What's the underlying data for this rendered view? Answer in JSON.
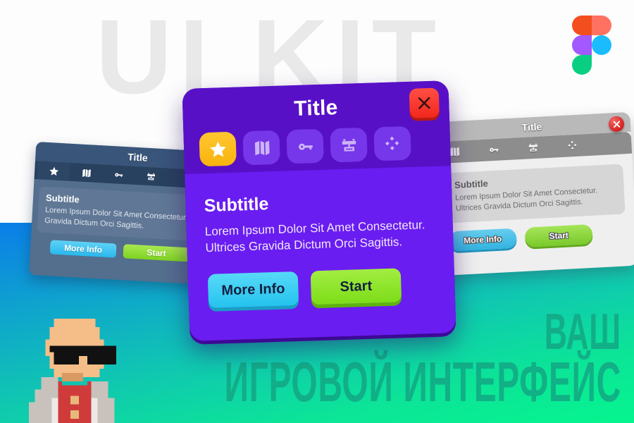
{
  "background": {
    "watermark_text": "UI KIT",
    "top_color": "#fdfdfd",
    "gradient_from": "#0a7ee8",
    "gradient_to": "#05f58f"
  },
  "figma_logo": {
    "name": "figma-logo",
    "colors": {
      "red": "#f24e1e",
      "salmon": "#ff7262",
      "purple": "#a259ff",
      "blue": "#1abcfe",
      "green": "#0acf83"
    }
  },
  "promo": {
    "line1": "ВАШ",
    "line2": "ИГРОВОЙ ИНТЕРФЕЙС",
    "color": "#13a583"
  },
  "mascot": {
    "name": "pixel-art-character",
    "skin": "#f5bd87",
    "skin_shadow": "#d99a63",
    "glasses": "#111111",
    "shirt": "#cf3b3b",
    "jacket": "#c9c1bb",
    "buttons": "#e8b87a"
  },
  "icons": {
    "star": "star-icon",
    "map": "map-icon",
    "key": "key-icon",
    "chest": "chest-icon",
    "gamepad": "gamepad-icon",
    "close": "close-icon"
  },
  "main_dialog": {
    "title": "Title",
    "subtitle": "Subtitle",
    "body": "Lorem Ipsum Dolor Sit Amet Consectetur. Ultrices Gravida Dictum Orci Sagittis.",
    "close_label": "Close",
    "accent": "#6a1df0",
    "header": "#5810c7",
    "active_tab_color": "#ffc731",
    "tabs": [
      {
        "label": "Favorites",
        "icon": "star-icon",
        "active": true
      },
      {
        "label": "Map",
        "icon": "map-icon",
        "active": false
      },
      {
        "label": "Keys",
        "icon": "key-icon",
        "active": false
      },
      {
        "label": "Inventory",
        "icon": "chest-icon",
        "active": false
      },
      {
        "label": "Controls",
        "icon": "gamepad-icon",
        "active": false
      }
    ],
    "buttons": {
      "more_info": "More Info",
      "start": "Start",
      "more_info_color": "#24c3ee",
      "start_color": "#7ddd18"
    }
  },
  "dark_dialog": {
    "title": "Title",
    "subtitle": "Subtitle",
    "body": "Lorem Ipsum Dolor Sit Amet Consectetur. Ultrices Gravida Dictum Orci Sagittis.",
    "accent": "#546e8e",
    "header": "#39557a",
    "tabs": [
      {
        "label": "Favorites",
        "icon": "star-icon",
        "active": true
      },
      {
        "label": "Map",
        "icon": "map-icon",
        "active": false
      },
      {
        "label": "Keys",
        "icon": "key-icon",
        "active": false
      },
      {
        "label": "Inventory",
        "icon": "chest-icon",
        "active": false
      }
    ],
    "buttons": {
      "more_info": "More Info",
      "start": "Start"
    }
  },
  "light_dialog": {
    "title": "Title",
    "subtitle": "Subtitle",
    "body": "Lorem Ipsum Dolor Sit Amet Consectetur. Ultrices Gravida Dictum Orci Sagittis.",
    "accent": "#efefef",
    "header": "#b9b9b9",
    "close_label": "Close",
    "tabs": [
      {
        "label": "Map",
        "icon": "map-icon",
        "active": false
      },
      {
        "label": "Keys",
        "icon": "key-icon",
        "active": false
      },
      {
        "label": "Inventory",
        "icon": "chest-icon",
        "active": false
      },
      {
        "label": "Controls",
        "icon": "gamepad-icon",
        "active": false
      }
    ],
    "buttons": {
      "more_info": "More Info",
      "start": "Start"
    }
  }
}
